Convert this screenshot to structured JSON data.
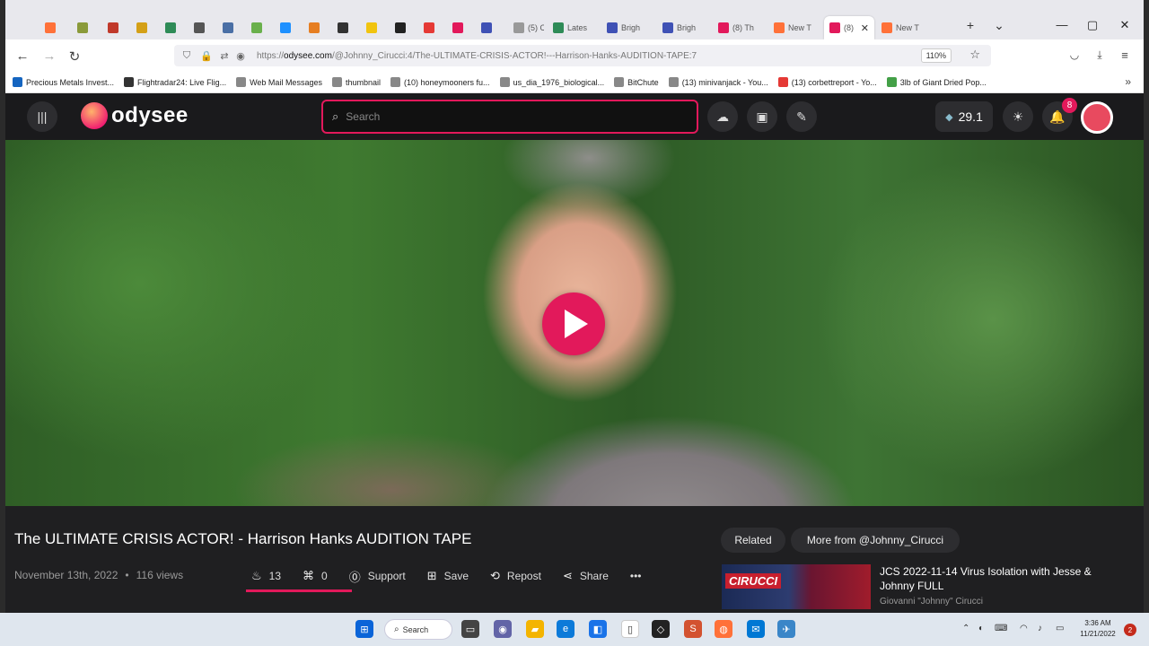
{
  "browser": {
    "tabs": [
      {
        "label": "",
        "color": "#ff7139"
      },
      {
        "label": "",
        "color": "#8a9a3a"
      },
      {
        "label": "",
        "color": "#c0392b"
      },
      {
        "label": "",
        "color": "#d4a017"
      },
      {
        "label": "",
        "color": "#2e8b57"
      },
      {
        "label": "",
        "color": "#555555"
      },
      {
        "label": "",
        "color": "#4a6fa5"
      },
      {
        "label": "",
        "color": "#6ab04c"
      },
      {
        "label": "",
        "color": "#1e90ff"
      },
      {
        "label": "",
        "color": "#e67e22"
      },
      {
        "label": "",
        "color": "#333333"
      },
      {
        "label": "",
        "color": "#f1c40f"
      },
      {
        "label": "",
        "color": "#222222"
      },
      {
        "label": "",
        "color": "#e53935"
      },
      {
        "label": "",
        "color": "#e2195b"
      },
      {
        "label": "",
        "color": "#3f51b5"
      },
      {
        "label": "(5) C",
        "color": "#999999"
      },
      {
        "label": "Lates",
        "color": "#2e8b57"
      },
      {
        "label": "Brigh",
        "color": "#3f51b5"
      },
      {
        "label": "Brigh",
        "color": "#3f51b5"
      },
      {
        "label": "(8) Th",
        "color": "#e2195b"
      },
      {
        "label": "New T",
        "color": "#ff7139"
      },
      {
        "label": "(8)",
        "color": "#e2195b"
      },
      {
        "label": "New T",
        "color": "#ff7139"
      }
    ],
    "new_tab": "+",
    "tab_list": "⌄",
    "close_tab": "✕",
    "window_controls": {
      "minimize": "—",
      "maximize": "▢",
      "close": "✕"
    },
    "nav": {
      "back": "←",
      "forward": "→",
      "reload": "↻"
    },
    "url": {
      "prefix": "https://",
      "domain": "odysee.com",
      "path": "/@Johnny_Cirucci:4/The-ULTIMATE-CRISIS-ACTOR!---Harrison-Hanks-AUDITION-TAPE:7"
    },
    "zoom": "110%",
    "bookmarks": [
      {
        "label": "Precious Metals Invest...",
        "color": "#1565c0"
      },
      {
        "label": "Flightradar24: Live Flig...",
        "color": "#333333"
      },
      {
        "label": "Web Mail Messages",
        "color": "#888888"
      },
      {
        "label": "thumbnail",
        "color": "#888888"
      },
      {
        "label": "(10) honeymooners fu...",
        "color": "#888888"
      },
      {
        "label": "us_dia_1976_biological...",
        "color": "#888888"
      },
      {
        "label": "BitChute",
        "color": "#888888"
      },
      {
        "label": "(13) minivanjack - You...",
        "color": "#888888"
      },
      {
        "label": "(13) corbettreport - Yo...",
        "color": "#e53935"
      },
      {
        "label": "3lb of Giant Dried Pop...",
        "color": "#43a047"
      }
    ],
    "bookmarks_more": "»"
  },
  "odysee": {
    "logo_text": "odysee",
    "search_placeholder": "Search",
    "credits": "29.1",
    "notifications": "8",
    "video": {
      "title": "The ULTIMATE CRISIS ACTOR! - Harrison Hanks AUDITION TAPE",
      "date": "November 13th, 2022",
      "views": "116 views",
      "fire_count": "13",
      "slime_count": "0",
      "support_label": "Support",
      "save_label": "Save",
      "repost_label": "Repost",
      "share_label": "Share",
      "more_label": "•••"
    },
    "sidebar": {
      "related_label": "Related",
      "more_from_label": "More from @Johnny_Cirucci",
      "related_item": {
        "title": "JCS 2022-11-14 Virus Isolation with Jesse & Johnny FULL",
        "author": "Giovanni \"Johnny\" Cirucci",
        "thumb_brand": "CIRUCCI"
      }
    }
  },
  "taskbar": {
    "search_label": "Search",
    "time": "3:36 AM",
    "date": "11/21/2022",
    "notification_count": "2"
  }
}
